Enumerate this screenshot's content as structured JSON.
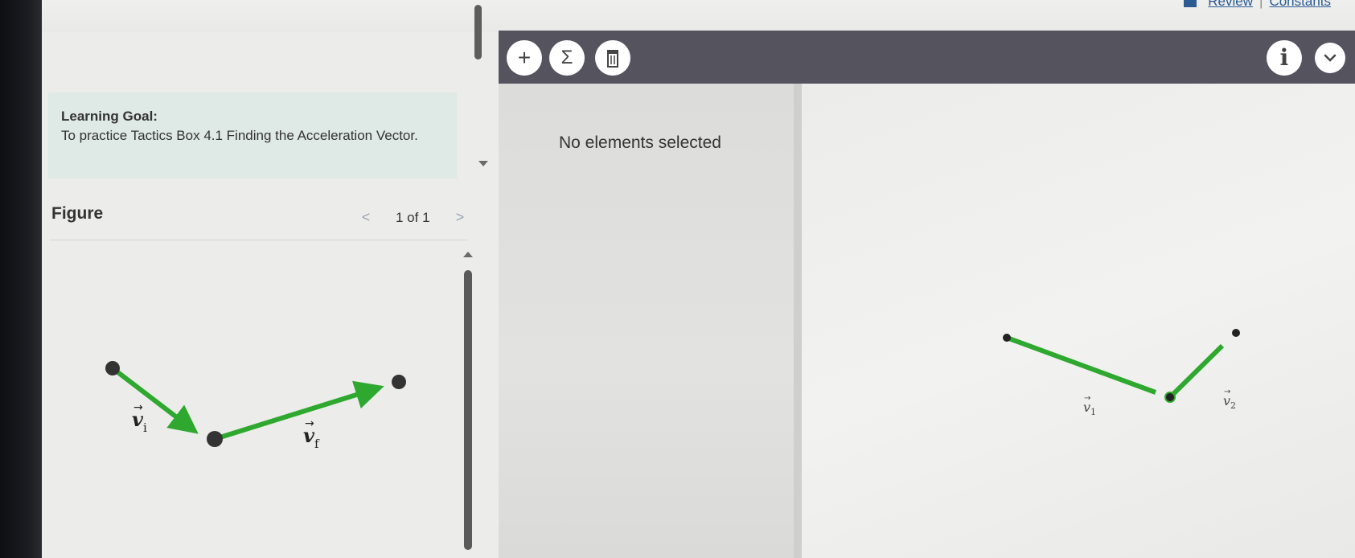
{
  "header": {
    "review_label": "Review",
    "separator": "|",
    "constants_label": "Constants"
  },
  "learning_goal": {
    "title": "Learning Goal:",
    "text": "To practice Tactics Box 4.1 Finding the Acceleration Vector."
  },
  "figure": {
    "title": "Figure",
    "prev_label": "<",
    "next_label": ">",
    "counter": "1 of 1",
    "vectors": [
      {
        "name": "vi",
        "label_main": "v",
        "label_sub": "i"
      },
      {
        "name": "vf",
        "label_main": "v",
        "label_sub": "f"
      }
    ]
  },
  "toolbar": {
    "add_label": "+",
    "sum_label": "Σ",
    "delete_label": "🗑",
    "info_label": "i",
    "menu_label": "⌄"
  },
  "side_pane": {
    "status": "No elements selected"
  },
  "drawing": {
    "vectors": [
      {
        "name": "v1",
        "label_main": "v",
        "label_sub": "1"
      },
      {
        "name": "v2",
        "label_main": "v",
        "label_sub": "2"
      }
    ]
  },
  "colors": {
    "vector_green": "#2ea82e",
    "toolbar_bg": "#54535e",
    "goal_bg": "#dfe9e6",
    "link_blue": "#2a5b93"
  }
}
